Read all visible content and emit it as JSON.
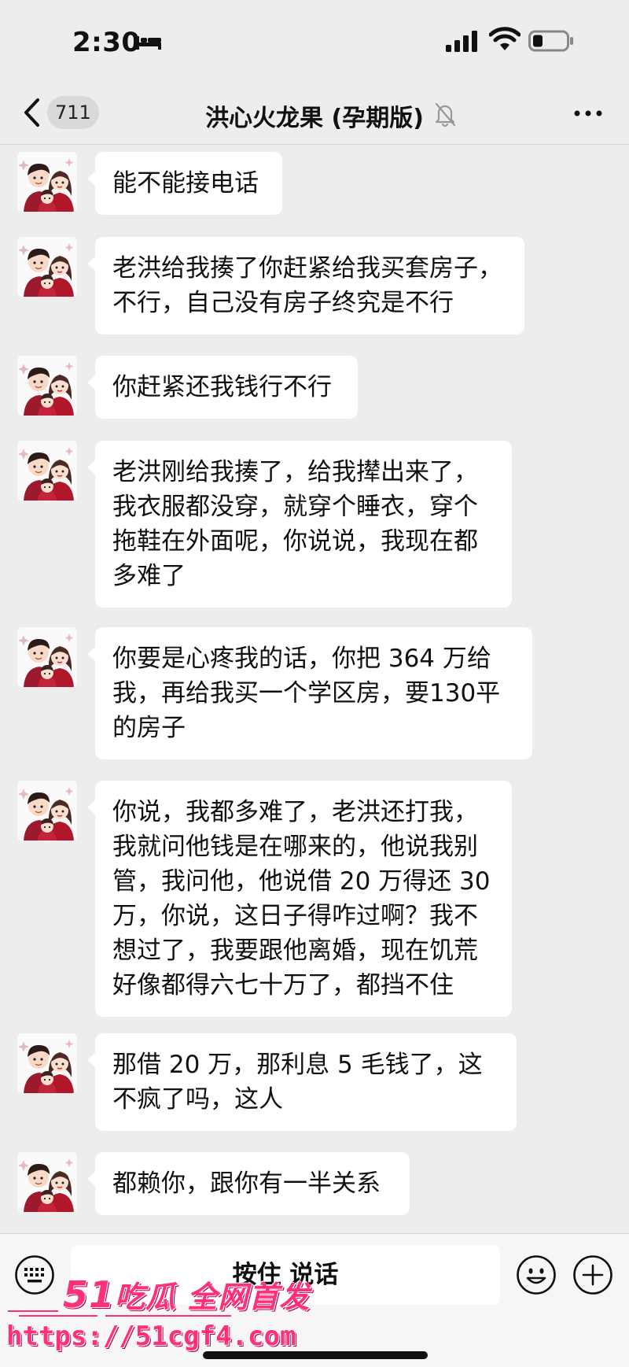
{
  "status_bar": {
    "time": "2:30",
    "icons": [
      "sleep-bed-icon",
      "cellular-signal-icon",
      "wifi-icon",
      "battery-icon"
    ]
  },
  "nav": {
    "unread_count": "711",
    "title": "洪心火龙果 (孕期版)",
    "icons": [
      "back-chevron-icon",
      "mute-bell-icon",
      "more-icon"
    ]
  },
  "messages": [
    {
      "text": "能不能接电话"
    },
    {
      "text": "老洪给我揍了你赶紧给我买套房子，不行，自己没有房子终究是不行"
    },
    {
      "text": "你赶紧还我钱行不行"
    },
    {
      "text": "老洪刚给我揍了，给我撵出来了，我衣服都没穿，就穿个睡衣，穿个拖鞋在外面呢，你说说，我现在都多难了"
    },
    {
      "text": "你要是心疼我的话，你把 364 万给我，再给我买一个学区房，要130平的房子"
    },
    {
      "text": "你说，我都多难了，老洪还打我，我就问他钱是在哪来的，他说我别管，我问他，他说借 20 万得还 30 万，你说，这日子得咋过啊？我不想过了，我要跟他离婚，现在饥荒好像都得六七十万了，都挡不住"
    },
    {
      "text": "那借 20 万，那利息 5 毛钱了，这不疯了吗，这人"
    },
    {
      "text": "都赖你，跟你有一半关系"
    }
  ],
  "input_bar": {
    "talk_label": "按住 说话",
    "icons": [
      "keyboard-icon",
      "emoji-icon",
      "plus-icon"
    ]
  },
  "watermark": {
    "line1_num": "51",
    "line1_text": "吃瓜 全网首发",
    "line2": "https://51cgf4.com"
  },
  "colors": {
    "background": "#ededed",
    "bubble": "#ffffff",
    "watermark": "#ff2f7a"
  }
}
